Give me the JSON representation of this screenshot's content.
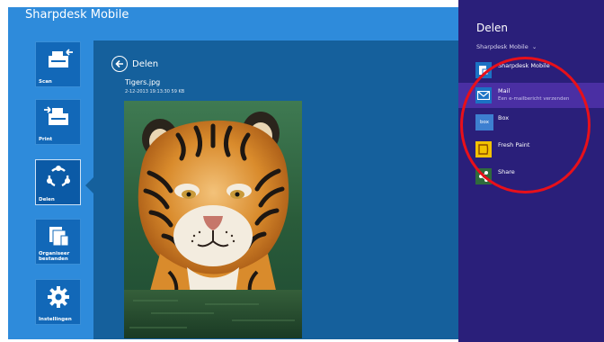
{
  "app": {
    "title": "Sharpdesk Mobile"
  },
  "nav": {
    "items": [
      {
        "label": "Scan"
      },
      {
        "label": "Print"
      },
      {
        "label": "Delen"
      },
      {
        "label": "Organiseer bestanden"
      },
      {
        "label": "Instellingen"
      }
    ]
  },
  "content": {
    "back_title": "Delen",
    "file_name": "Tigers.jpg",
    "file_meta": "2-12-2013 19:13:30  59 KB"
  },
  "charm": {
    "title": "Delen",
    "app_dropdown": "Sharpdesk Mobile",
    "items": [
      {
        "name": "Sharpdesk Mobile",
        "icon": "sharpdesk-icon"
      },
      {
        "name": "Mail",
        "sub": "Een e-mailbericht verzenden",
        "icon": "mail-icon"
      },
      {
        "name": "Box",
        "icon_text": "box",
        "icon": "box-icon"
      },
      {
        "name": "Fresh Paint",
        "icon": "fresh-paint-icon"
      },
      {
        "name": "Share",
        "icon": "share-icon"
      }
    ]
  },
  "colors": {
    "app_blue": "#2e8bdb",
    "content_blue": "#15609c",
    "charm_purple": "#2a1f7a",
    "selected_purple": "#4a2fa3",
    "highlight_red": "#e8101a"
  }
}
